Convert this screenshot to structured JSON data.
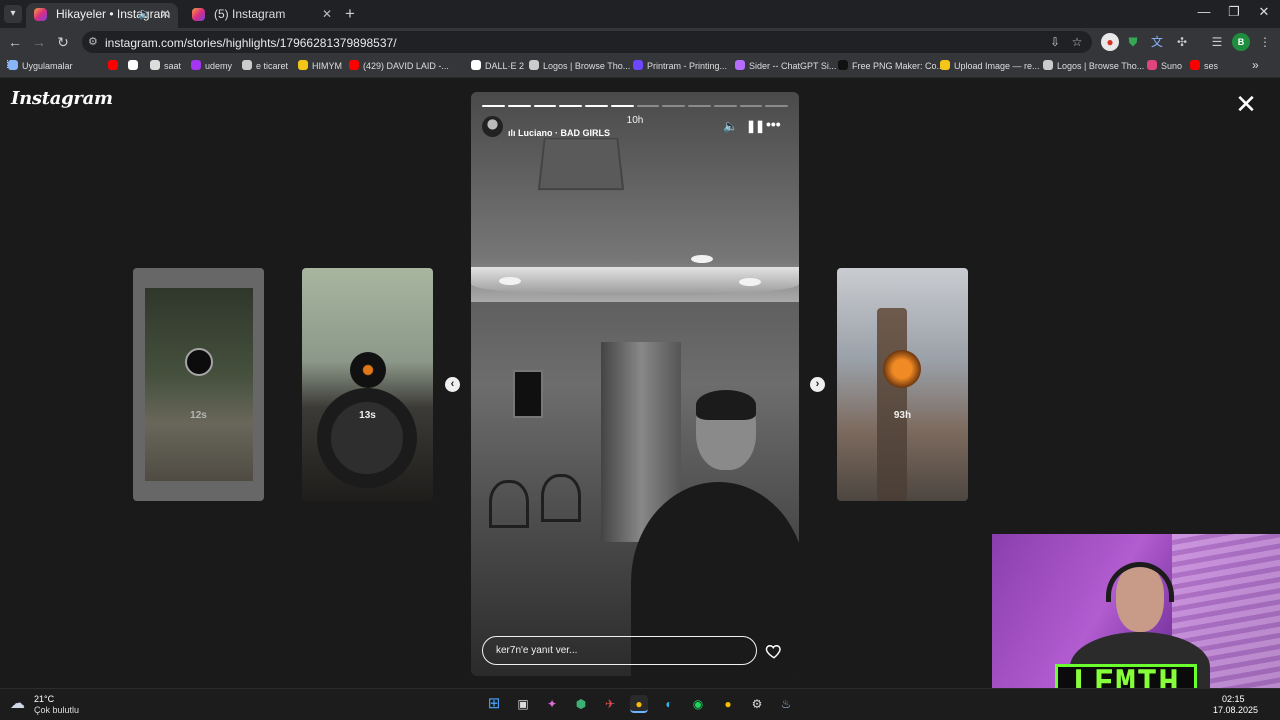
{
  "browser": {
    "tabs": [
      {
        "title": "Hikayeler • Instagram",
        "active": true
      },
      {
        "title": "(5) Instagram",
        "active": false
      }
    ],
    "new_tab_symbol": "+",
    "window_controls": {
      "minimize": "—",
      "restore": "❐",
      "close": "✕"
    },
    "nav": {
      "back": "←",
      "forward": "→",
      "reload": "↻"
    },
    "url": "instagram.com/stories/highlights/17966281379898537/",
    "profile_initial": "B",
    "bookmarks": [
      {
        "label": "Uygulamalar",
        "color": "#8ab4f8"
      },
      {
        "label": "",
        "color": "#ff0000"
      },
      {
        "label": "",
        "color": "#ffffff"
      },
      {
        "label": "saat",
        "color": "#dddddd"
      },
      {
        "label": "udemy",
        "color": "#a435f0"
      },
      {
        "label": "e ticaret",
        "color": "#cccccc"
      },
      {
        "label": "HIMYM",
        "color": "#f5c518"
      },
      {
        "label": "(429) DAVID LAID -...",
        "color": "#ff0000"
      },
      {
        "label": "DALL·E 2",
        "color": "#ffffff"
      },
      {
        "label": "Logos | Browse Tho...",
        "color": "#cccccc"
      },
      {
        "label": "Printram - Printing...",
        "color": "#6c47ff"
      },
      {
        "label": "Sider -- ChatGPT Si...",
        "color": "#b66cff"
      },
      {
        "label": "Free PNG Maker: Co...",
        "color": "#111111"
      },
      {
        "label": "Upload Image — re...",
        "color": "#f5c518"
      },
      {
        "label": "Logos | Browse Tho...",
        "color": "#cccccc"
      },
      {
        "label": "Suno",
        "color": "#e0457b"
      },
      {
        "label": "ses",
        "color": "#ff0000"
      }
    ],
    "bookmarks_more": "»"
  },
  "instagram": {
    "logo": "Instagram",
    "close_symbol": "✕",
    "previews": [
      {
        "time": "12s"
      },
      {
        "time": "13s"
      },
      {
        "time": "93h"
      }
    ],
    "story": {
      "segments_total": 12,
      "segments_done": 6,
      "time": "10h",
      "music": "Luciano · BAD GIRLS",
      "reply_placeholder": "ker7n'e yanıt ver..."
    },
    "nav_prev": "‹",
    "nav_next": "›"
  },
  "webcam": {
    "brand": "LEMTH"
  },
  "taskbar": {
    "weather_temp": "21°C",
    "weather_desc": "Çok bulutlu",
    "time": "02:15",
    "date": "17.08.2025"
  }
}
